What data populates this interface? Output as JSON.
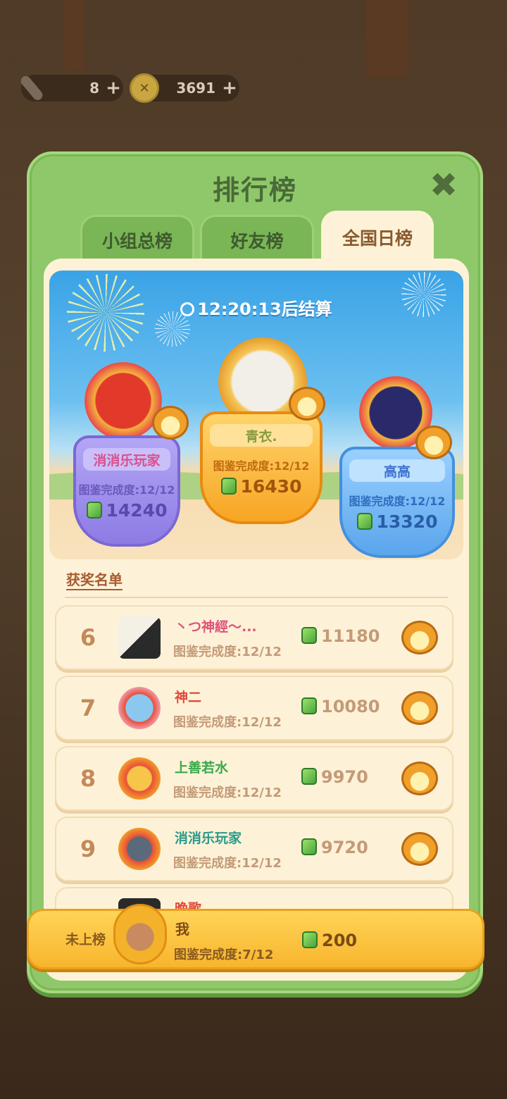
{
  "currency": {
    "rockets": "8",
    "coins": "3691",
    "plus": "+"
  },
  "panel": {
    "title": "排行榜",
    "close": "✖"
  },
  "tabs": [
    {
      "label": "小组总榜",
      "active": false
    },
    {
      "label": "好友榜",
      "active": false
    },
    {
      "label": "全国日榜",
      "active": true
    }
  ],
  "timer": "12:20:13后结算",
  "podium": [
    {
      "rank": 2,
      "name": "消消乐玩家",
      "progress": "图鉴完成度:12/12",
      "score": "14240"
    },
    {
      "rank": 1,
      "name": "青衣.",
      "progress": "图鉴完成度:12/12",
      "score": "16430"
    },
    {
      "rank": 3,
      "name": "高高",
      "progress": "图鉴完成度:12/12",
      "score": "13320"
    }
  ],
  "award_list_label": "获奖名单",
  "ranks": [
    {
      "rank": "6",
      "name": "丶つ神經～...",
      "progress": "图鉴完成度:12/12",
      "score": "11180",
      "name_color": "#e0507a"
    },
    {
      "rank": "7",
      "name": "神二",
      "progress": "图鉴完成度:12/12",
      "score": "10080",
      "name_color": "#e04a3a"
    },
    {
      "rank": "8",
      "name": "上善若水",
      "progress": "图鉴完成度:12/12",
      "score": "9970",
      "name_color": "#3aa84a"
    },
    {
      "rank": "9",
      "name": "消消乐玩家",
      "progress": "图鉴完成度:12/12",
      "score": "9720",
      "name_color": "#2a9a8a"
    },
    {
      "rank": "",
      "name": "晚歌",
      "progress": "",
      "score": "",
      "name_color": "#e04a3a"
    }
  ],
  "me": {
    "status": "未上榜",
    "name": "我",
    "progress": "图鉴完成度:7/12",
    "score": "200"
  },
  "colors": {
    "panel_green": "#8fc86a",
    "cream": "#fdf2d7",
    "gold": "#f8b52e"
  }
}
